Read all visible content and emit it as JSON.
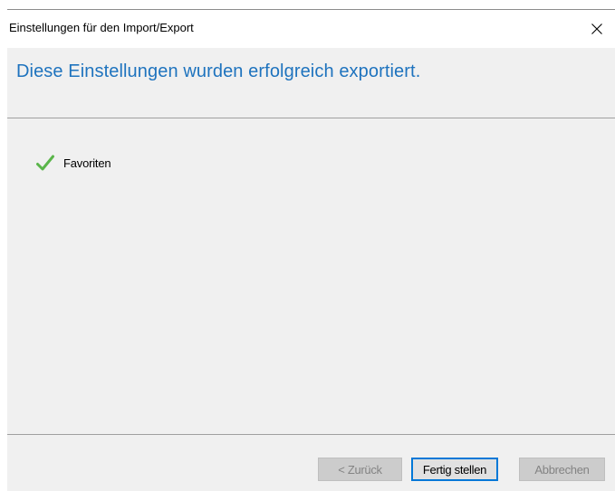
{
  "window": {
    "title": "Einstellungen für den Import/Export",
    "close_icon": "close-icon"
  },
  "header": {
    "heading": "Diese Einstellungen wurden erfolgreich exportiert.",
    "accent_color": "#1e73be"
  },
  "content": {
    "items": [
      {
        "label": "Favoriten",
        "status_icon": "checkmark-icon",
        "status_color": "#5ab54a"
      }
    ]
  },
  "footer": {
    "back_label": "< Zurück",
    "finish_label": "Fertig stellen",
    "cancel_label": "Abbrechen"
  }
}
